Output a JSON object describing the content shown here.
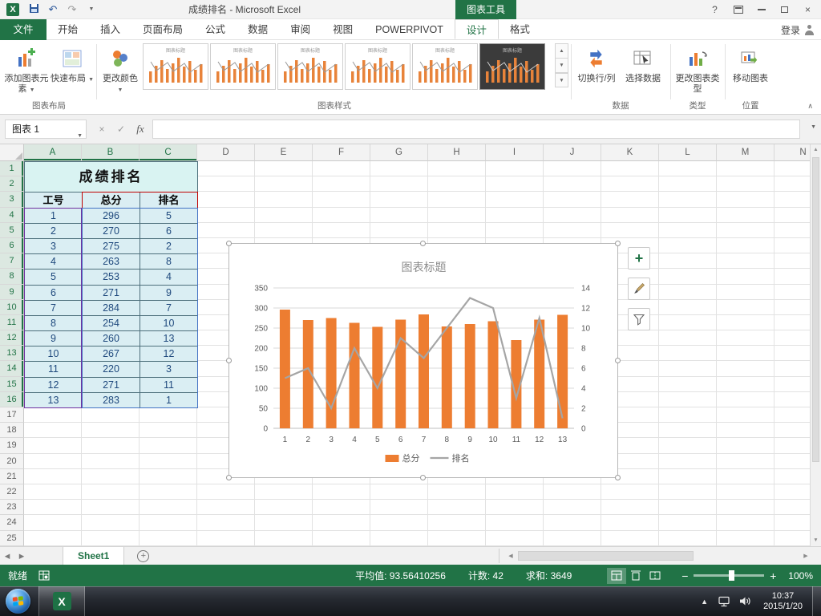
{
  "colors": {
    "excel_green": "#217346",
    "bar_orange": "#ED7D31",
    "line_gray": "#A5A5A5",
    "selection_blue": "#4472C4",
    "selection_purple": "#7030A0",
    "selection_red": "#C00000",
    "cell_bg": "#DAEEF3"
  },
  "titlebar": {
    "title": "成绩排名 - Microsoft Excel",
    "chart_tools": "图表工具"
  },
  "ribbon": {
    "file_tab": "文件",
    "tabs": [
      "开始",
      "插入",
      "页面布局",
      "公式",
      "数据",
      "审阅",
      "视图",
      "POWERPIVOT",
      "设计",
      "格式"
    ],
    "active_tab": "设计",
    "sign_in": "登录",
    "groups": [
      {
        "label": "图表布局"
      },
      {
        "label": "图表样式"
      },
      {
        "label": "数据"
      },
      {
        "label": "类型"
      },
      {
        "label": "位置"
      }
    ],
    "buttons": {
      "add_element": "添加图表元素",
      "quick_layout": "快速布局",
      "change_colors": "更改颜色",
      "switch_row_col": "切换行/列",
      "select_data": "选择数据",
      "change_type": "更改图表类型",
      "move_chart": "移动图表"
    }
  },
  "formula_bar": {
    "name_box": "图表 1",
    "fx": "fx",
    "value": ""
  },
  "sheet": {
    "columns": [
      "A",
      "B",
      "C",
      "D",
      "E",
      "F",
      "G",
      "H",
      "I",
      "J",
      "K",
      "L",
      "M",
      "N"
    ],
    "row_count": 25,
    "tab_name": "Sheet1",
    "table": {
      "title": "成绩排名",
      "headers": [
        "工号",
        "总分",
        "排名"
      ],
      "rows": [
        [
          1,
          296,
          5
        ],
        [
          2,
          270,
          6
        ],
        [
          3,
          275,
          2
        ],
        [
          4,
          263,
          8
        ],
        [
          5,
          253,
          4
        ],
        [
          6,
          271,
          9
        ],
        [
          7,
          284,
          7
        ],
        [
          8,
          254,
          10
        ],
        [
          9,
          260,
          13
        ],
        [
          10,
          267,
          12
        ],
        [
          11,
          220,
          3
        ],
        [
          12,
          271,
          11
        ],
        [
          13,
          283,
          1
        ]
      ]
    }
  },
  "chart_data": {
    "type": "bar",
    "title": "图表标题",
    "categories": [
      "1",
      "2",
      "3",
      "4",
      "5",
      "6",
      "7",
      "8",
      "9",
      "10",
      "11",
      "12",
      "13"
    ],
    "series": [
      {
        "name": "总分",
        "type": "bar",
        "axis": "primary",
        "color": "#ED7D31",
        "values": [
          296,
          270,
          275,
          263,
          253,
          271,
          284,
          254,
          260,
          267,
          220,
          271,
          283
        ]
      },
      {
        "name": "排名",
        "type": "line",
        "axis": "secondary",
        "color": "#A5A5A5",
        "values": [
          5,
          6,
          2,
          8,
          4,
          9,
          7,
          10,
          13,
          12,
          3,
          11,
          1
        ]
      }
    ],
    "primary_axis": {
      "min": 0,
      "max": 350,
      "step": 50
    },
    "secondary_axis": {
      "min": 0,
      "max": 14,
      "step": 2
    },
    "legend_position": "bottom",
    "gridlines": true
  },
  "status_bar": {
    "mode": "就绪",
    "average": "平均值: 93.56410256",
    "count": "计数: 42",
    "sum": "求和: 3649",
    "zoom": "100%"
  },
  "taskbar": {
    "time": "10:37",
    "date": "2015/1/20"
  },
  "icons": {
    "undo": "↶",
    "redo": "↷",
    "dropdown": "▼",
    "help": "?",
    "close": "×",
    "cancel": "×",
    "check": "✓",
    "left": "◀",
    "right": "▶",
    "up": "▲",
    "down": "▼",
    "plus": "+",
    "collapse": "∧",
    "app_letter": "X"
  }
}
